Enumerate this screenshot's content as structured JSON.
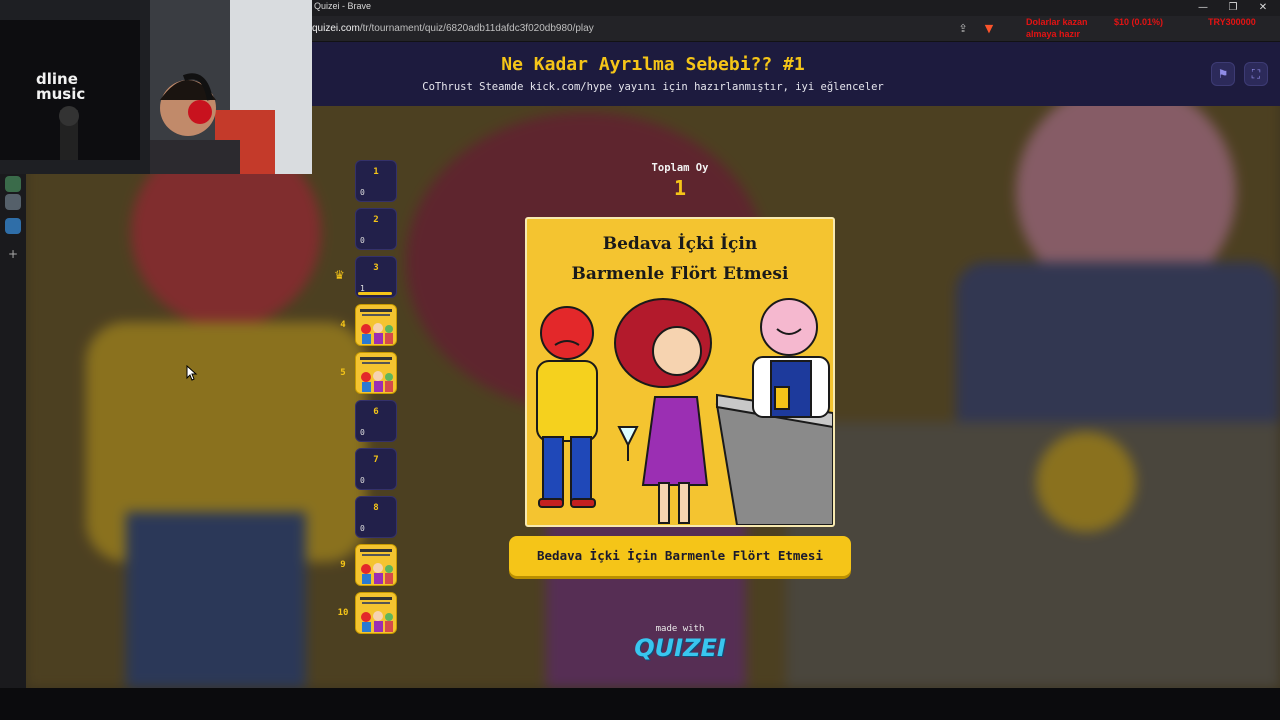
{
  "browser": {
    "window_title": "Quizei - Brave",
    "url_host": "quizei.com",
    "url_path": "/tr/tournament/quiz/6820adb11dafdc3f020db980/play",
    "overlay_line1": "Dolarlar kazan",
    "overlay_val1": "$10 (0.01%)",
    "overlay_val2": "TRY300000",
    "overlay_line2": "almaya hazır"
  },
  "webcam": {
    "logo_text": "dline music"
  },
  "header": {
    "title": "Ne Kadar Ayrılma Sebebi?? #1",
    "subtitle": "CoThrust Steamde kick.com/hype yayını için hazırlanmıştır, iyi eğlenceler"
  },
  "bracket": [
    {
      "num": "1",
      "votes": "0",
      "has_image": false
    },
    {
      "num": "2",
      "votes": "0",
      "has_image": false
    },
    {
      "num": "3",
      "votes": "1",
      "has_image": false,
      "fill": 0.9
    },
    {
      "num": "4",
      "votes": "",
      "has_image": true
    },
    {
      "num": "5",
      "votes": "",
      "has_image": true
    },
    {
      "num": "6",
      "votes": "0",
      "has_image": false
    },
    {
      "num": "7",
      "votes": "0",
      "has_image": false
    },
    {
      "num": "8",
      "votes": "0",
      "has_image": false
    },
    {
      "num": "9",
      "votes": "",
      "has_image": true
    },
    {
      "num": "10",
      "votes": "",
      "has_image": true
    }
  ],
  "total": {
    "label": "Toplam Oy",
    "value": "1"
  },
  "card": {
    "caption_line1": "Bedava İçki İçin",
    "caption_line2": "Barmenle Flört Etmesi"
  },
  "choice": {
    "label": "Bedava İçki İçin Barmenle Flört Etmesi"
  },
  "footer": {
    "made_with": "made with",
    "logo": "QUIZEI"
  },
  "colors": {
    "accent": "#f5c518",
    "header_bg": "#1d1b3e",
    "slot_bg": "#22204a",
    "logo": "#39c6ef"
  }
}
